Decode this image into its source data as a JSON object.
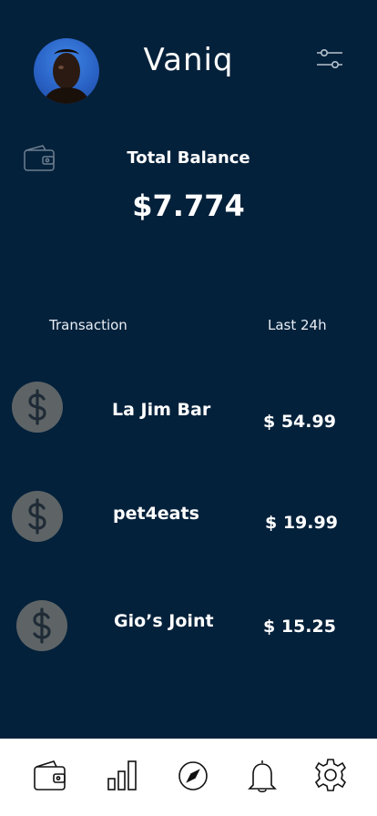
{
  "header": {
    "title": "Vaniq",
    "avatar_icon": "user-avatar",
    "filter_icon": "sliders-icon"
  },
  "balance": {
    "label": "Total Balance",
    "value": "$7.774",
    "icon": "wallet-icon"
  },
  "transactions": {
    "title": "Transaction",
    "period": "Last 24h",
    "items": [
      {
        "name": "La Jim Bar",
        "amount": "$ 54.99",
        "icon": "dollar-icon"
      },
      {
        "name": "pet4eats",
        "amount": "$ 19.99",
        "icon": "dollar-icon"
      },
      {
        "name": "Gio’s Joint",
        "amount": "$ 15.25",
        "icon": "dollar-icon"
      }
    ]
  },
  "bottom_nav": {
    "items": [
      "wallet-icon",
      "bar-chart-icon",
      "compass-icon",
      "bell-icon",
      "gear-icon"
    ]
  },
  "colors": {
    "background": "#04213b",
    "coin": "#5e6466",
    "nav_background": "#ffffff"
  }
}
